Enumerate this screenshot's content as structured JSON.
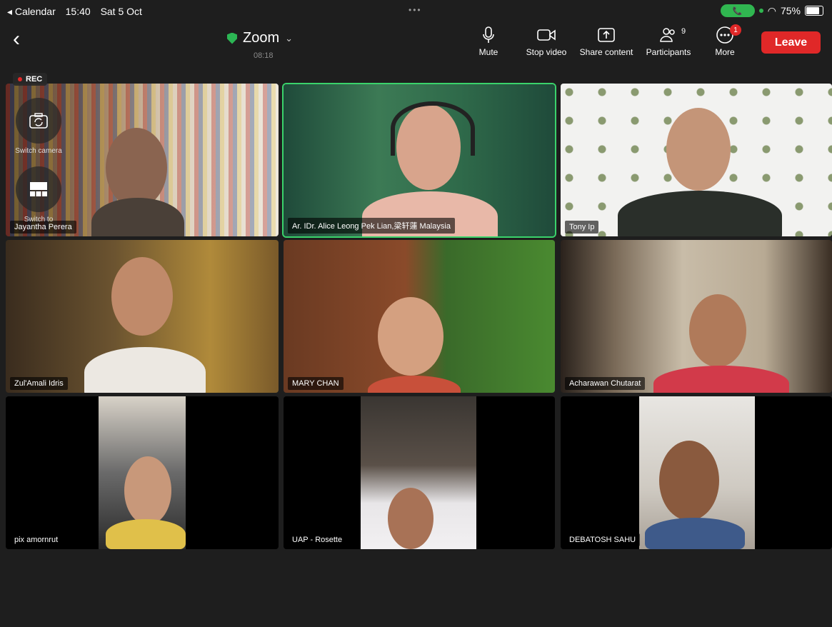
{
  "status_bar": {
    "back_app": "◂ Calendar",
    "time": "15:40",
    "date": "Sat 5 Oct",
    "battery": "75%"
  },
  "toolbar": {
    "title": "Zoom",
    "timer": "08:18",
    "mute": "Mute",
    "stop_video": "Stop video",
    "share": "Share content",
    "participants": "Participants",
    "participants_count": "9",
    "more": "More",
    "more_badge": "1",
    "leave": "Leave"
  },
  "recording": {
    "label": "REC"
  },
  "overlays": {
    "switch_camera": "Switch camera",
    "switch_layout": "Switch to"
  },
  "participants": [
    {
      "name": "Jayantha Perera"
    },
    {
      "name": "Ar. IDr. Alice Leong Pek Lian,梁轩蓮 Malaysia"
    },
    {
      "name": "Tony Ip"
    },
    {
      "name": "Zul'Amali Idris"
    },
    {
      "name": "MARY CHAN"
    },
    {
      "name": "Acharawan Chutarat"
    },
    {
      "name": "pix amornrut"
    },
    {
      "name": "UAP - Rosette"
    },
    {
      "name": "DEBATOSH SAHU"
    }
  ],
  "colors": {
    "accent_green": "#3ad36b",
    "leave_red": "#e02828",
    "background": "#1e1e1e"
  }
}
